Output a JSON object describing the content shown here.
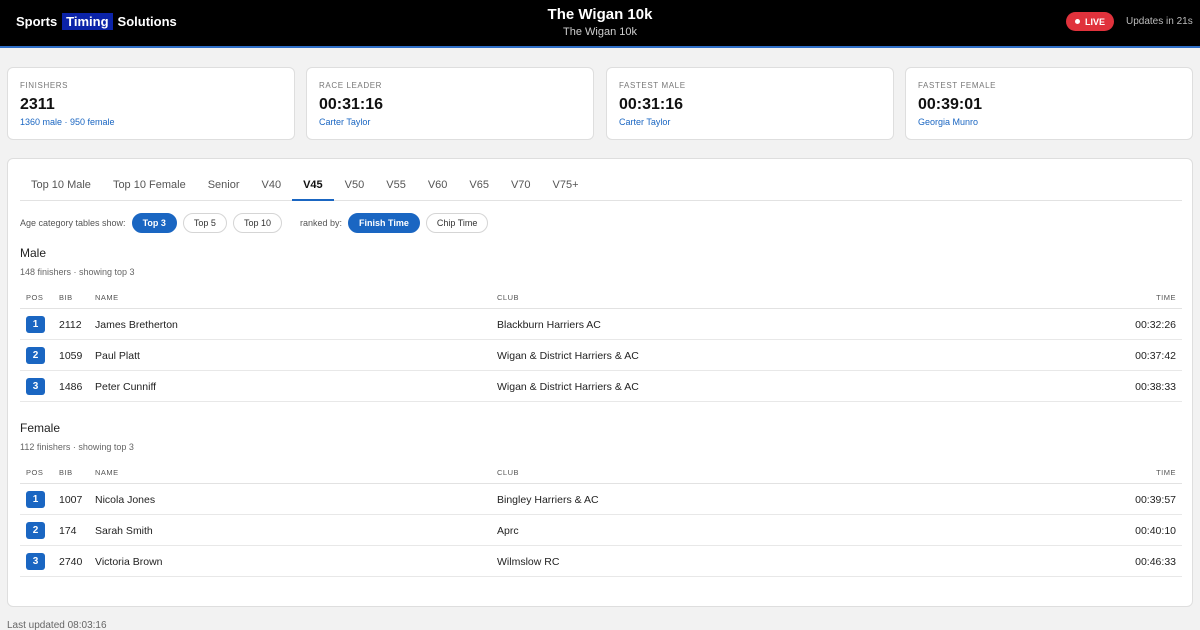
{
  "header": {
    "brand_pre": "Sports",
    "brand_hl": "Timing",
    "brand_post": "Solutions",
    "title": "The Wigan 10k",
    "subtitle": "The Wigan 10k",
    "live": "LIVE",
    "updates": "Updates in 21s"
  },
  "stats": [
    {
      "label": "FINISHERS",
      "value": "2311",
      "sub": "1360 male · 950 female"
    },
    {
      "label": "RACE LEADER",
      "value": "00:31:16",
      "sub": "Carter Taylor"
    },
    {
      "label": "FASTEST MALE",
      "value": "00:31:16",
      "sub": "Carter Taylor"
    },
    {
      "label": "FASTEST FEMALE",
      "value": "00:39:01",
      "sub": "Georgia Munro"
    }
  ],
  "tabs": [
    "Top 10 Male",
    "Top 10 Female",
    "Senior",
    "V40",
    "V45",
    "V50",
    "V55",
    "V60",
    "V65",
    "V70",
    "V75+"
  ],
  "active_tab": "V45",
  "filters": {
    "show_label": "Age category tables show:",
    "show_opts": [
      "Top 3",
      "Top 5",
      "Top 10"
    ],
    "ranked_label": "ranked by:",
    "rank_opts": [
      "Finish Time",
      "Chip Time"
    ]
  },
  "columns": {
    "pos": "POS",
    "bib": "BIB",
    "name": "NAME",
    "club": "CLUB",
    "time": "TIME"
  },
  "male": {
    "title": "Male",
    "sub": "148 finishers · showing top 3",
    "rows": [
      {
        "pos": "1",
        "bib": "2112",
        "name": "James Bretherton",
        "club": "Blackburn Harriers AC",
        "time": "00:32:26"
      },
      {
        "pos": "2",
        "bib": "1059",
        "name": "Paul Platt",
        "club": "Wigan & District Harriers & AC",
        "time": "00:37:42"
      },
      {
        "pos": "3",
        "bib": "1486",
        "name": "Peter Cunniff",
        "club": "Wigan & District Harriers & AC",
        "time": "00:38:33"
      }
    ]
  },
  "female": {
    "title": "Female",
    "sub": "112 finishers · showing top 3",
    "rows": [
      {
        "pos": "1",
        "bib": "1007",
        "name": "Nicola Jones",
        "club": "Bingley Harriers & AC",
        "time": "00:39:57"
      },
      {
        "pos": "2",
        "bib": "174",
        "name": "Sarah Smith",
        "club": "Aprc",
        "time": "00:40:10"
      },
      {
        "pos": "3",
        "bib": "2740",
        "name": "Victoria Brown",
        "club": "Wilmslow RC",
        "time": "00:46:33"
      }
    ]
  },
  "footer": "Last updated 08:03:16",
  "colors": {
    "accent": "#1a66c2",
    "live": "#e0323c",
    "brand_highlight": "#0b23a8"
  }
}
